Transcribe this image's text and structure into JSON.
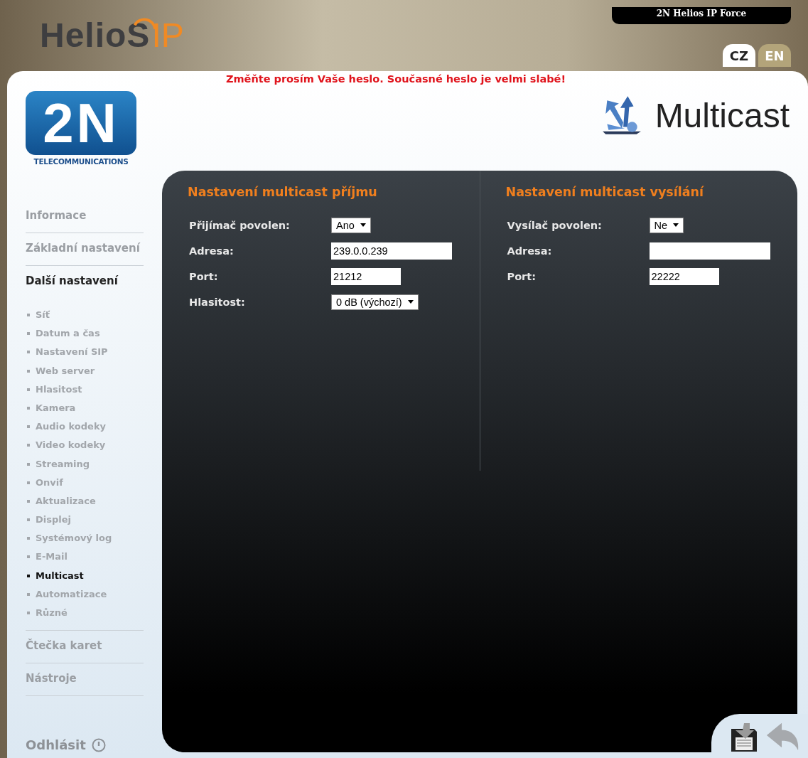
{
  "header": {
    "logo_text": "HelioS",
    "logo_suffix": "IP",
    "device_name": "2N Helios IP Force",
    "languages": [
      {
        "label": "CZ",
        "selected": true
      },
      {
        "label": "EN",
        "selected": false
      }
    ]
  },
  "warning": "Změňte prosím Vaše heslo. Současné heslo je velmi slabé!",
  "brand": {
    "mark": "2N",
    "tagline": "TELECOMMUNICATIONS"
  },
  "page_title": "Multicast",
  "sidebar": {
    "items": [
      {
        "label": "Informace",
        "selected": false
      },
      {
        "label": "Základní nastavení",
        "selected": false
      },
      {
        "label": "Další nastavení",
        "selected": true,
        "children": [
          {
            "label": "Síť",
            "selected": false
          },
          {
            "label": "Datum a čas",
            "selected": false
          },
          {
            "label": "Nastavení SIP",
            "selected": false
          },
          {
            "label": "Web server",
            "selected": false
          },
          {
            "label": "Hlasitost",
            "selected": false
          },
          {
            "label": "Kamera",
            "selected": false
          },
          {
            "label": "Audio kodeky",
            "selected": false
          },
          {
            "label": "Video kodeky",
            "selected": false
          },
          {
            "label": "Streaming",
            "selected": false
          },
          {
            "label": "Onvif",
            "selected": false
          },
          {
            "label": "Aktualizace",
            "selected": false
          },
          {
            "label": "Displej",
            "selected": false
          },
          {
            "label": "Systémový log",
            "selected": false
          },
          {
            "label": "E-Mail",
            "selected": false
          },
          {
            "label": "Multicast",
            "selected": true
          },
          {
            "label": "Automatizace",
            "selected": false
          },
          {
            "label": "Různé",
            "selected": false
          }
        ]
      },
      {
        "label": "Čtečka karet",
        "selected": false
      },
      {
        "label": "Nástroje",
        "selected": false
      }
    ],
    "logout": "Odhlásit"
  },
  "panels": [
    {
      "title": "Nastavení multicast příjmu",
      "fields": [
        {
          "label": "Přijímač povolen:",
          "kind": "select",
          "value": "Ano"
        },
        {
          "label": "Adresa:",
          "kind": "text",
          "value": "239.0.0.239"
        },
        {
          "label": "Port:",
          "kind": "text",
          "value": "21212"
        },
        {
          "label": "Hlasitost:",
          "kind": "select",
          "value": "0 dB (výchozí)"
        }
      ]
    },
    {
      "title": "Nastavení multicast vysílání",
      "fields": [
        {
          "label": "Vysílač povolen:",
          "kind": "select",
          "value": "Ne"
        },
        {
          "label": "Adresa:",
          "kind": "text"
        },
        {
          "label": "Port:",
          "kind": "text",
          "value": "22222"
        }
      ]
    }
  ]
}
